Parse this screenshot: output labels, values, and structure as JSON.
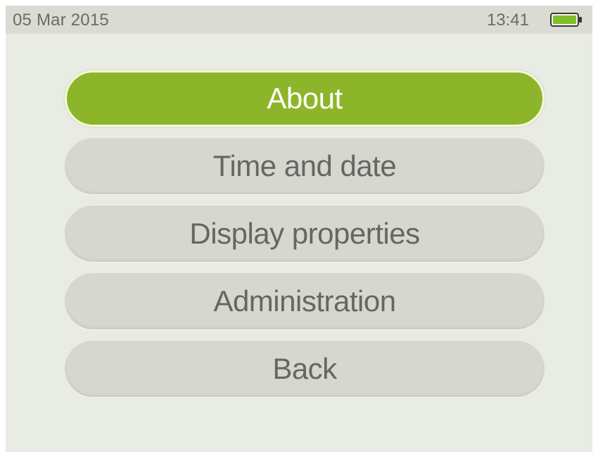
{
  "status": {
    "date": "05 Mar 2015",
    "time": "13:41",
    "battery_icon": "battery-full-icon",
    "battery_color": "#7fbf2a"
  },
  "menu": {
    "items": [
      {
        "label": "About",
        "selected": true
      },
      {
        "label": "Time and date",
        "selected": false
      },
      {
        "label": "Display properties",
        "selected": false
      },
      {
        "label": "Administration",
        "selected": false
      },
      {
        "label": "Back",
        "selected": false
      }
    ]
  },
  "colors": {
    "accent": "#8db52a",
    "button": "#d6d8d0",
    "background": "#e9ece4"
  }
}
